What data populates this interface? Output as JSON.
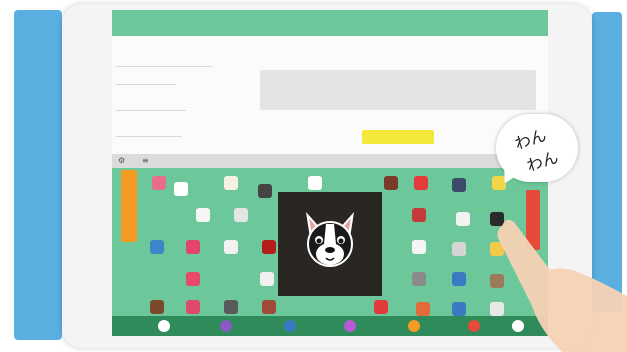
{
  "app": {
    "title": "",
    "right_header": ""
  },
  "form": {
    "fields": [
      {
        "label": ""
      },
      {
        "label": ""
      },
      {
        "label": ""
      },
      {
        "label": ""
      }
    ]
  },
  "speech_bubble": {
    "line1": "わん",
    "line2": "わん"
  },
  "colors": {
    "app_green": "#6cc89a",
    "palette_green": "#6cc89a",
    "accent_orange": "#f59a23",
    "accent_red": "#e54a3a",
    "button_yellow": "#f4e83a",
    "bottom_bar": "#2f8c5a"
  },
  "icons": {
    "toolbar_left": "settings-icon",
    "toolbar_right": "menu-icon",
    "popup": "boston-terrier-sticker",
    "bottom_bar": [
      "purple-dot",
      "blue-dot",
      "orange-dot",
      "red-dot",
      "white-dot"
    ]
  }
}
